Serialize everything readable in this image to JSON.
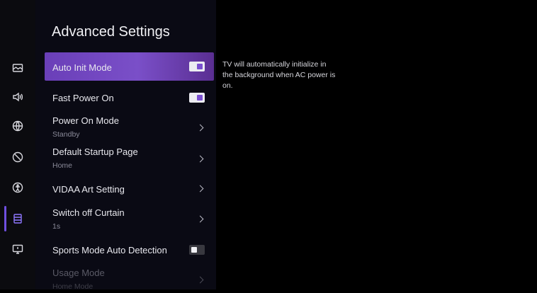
{
  "panel": {
    "title": "Advanced Settings"
  },
  "description": "TV will automatically initialize in the background when AC power is on.",
  "rail": {
    "icons": [
      "picture-icon",
      "sound-icon",
      "network-icon",
      "accessibility-icon",
      "support-icon",
      "system-icon",
      "device-icon"
    ],
    "active_index": 5
  },
  "items": [
    {
      "label": "Auto Init Mode",
      "type": "toggle",
      "state": "on",
      "focused": true
    },
    {
      "label": "Fast Power On",
      "type": "toggle",
      "state": "on"
    },
    {
      "label": "Power On Mode",
      "sub": "Standby",
      "type": "nav"
    },
    {
      "label": "Default Startup Page",
      "sub": "Home",
      "type": "nav"
    },
    {
      "label": "VIDAA Art Setting",
      "type": "nav"
    },
    {
      "label": "Switch off Curtain",
      "sub": "1s",
      "type": "nav"
    },
    {
      "label": "Sports Mode Auto Detection",
      "type": "toggle",
      "state": "off"
    },
    {
      "label": "Usage Mode",
      "sub": "Home Mode",
      "type": "nav",
      "disabled": true
    }
  ],
  "colors": {
    "accent": "#7a4fd0",
    "focus_start": "#6a3fb8",
    "background": "#000000"
  }
}
